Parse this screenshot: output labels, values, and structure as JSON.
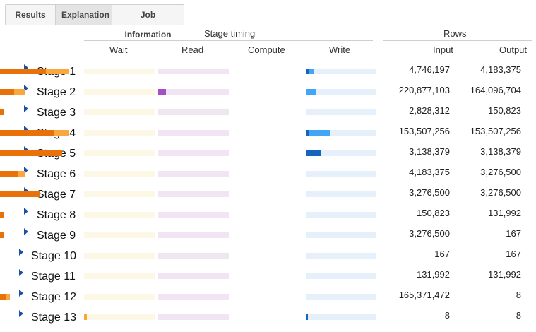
{
  "tabs": [
    "Results",
    "Explanation",
    "Job Information"
  ],
  "active_tab": "Explanation",
  "table": {
    "stage_timing_header": "Stage timing",
    "rows_header": "Rows",
    "columns": {
      "wait": "Wait",
      "read": "Read",
      "compute": "Compute",
      "write": "Write",
      "input": "Input",
      "output": "Output"
    }
  },
  "colors": {
    "wait_avg": "#f7a833",
    "wait_bg": "#fdf8e6",
    "read_avg": "#a64fc3",
    "read_max": "#d9aee5",
    "read_bg": "#f1e4f3",
    "compute_avg": "#e8710a",
    "compute_max": "#f9a73e",
    "compute_bg": "#fdefdc",
    "write_avg": "#1565c0",
    "write_max": "#42a5f5",
    "write_bg": "#e6f0fa",
    "expand_icon": "#1e4fa8"
  },
  "stages": [
    {
      "name": "Stage 1",
      "input": "4,746,197",
      "output": "4,183,375",
      "wait": [
        0,
        0
      ],
      "read": [
        0,
        0
      ],
      "compute": [
        0.65,
        0.98
      ],
      "write": [
        0.05,
        0.11
      ]
    },
    {
      "name": "Stage 2",
      "input": "220,877,103",
      "output": "164,096,704",
      "wait": [
        0,
        0
      ],
      "read": [
        0.11,
        0.11
      ],
      "compute": [
        0.2,
        0.36
      ],
      "write": [
        0.01,
        0.15
      ]
    },
    {
      "name": "Stage 3",
      "input": "2,828,312",
      "output": "150,823",
      "wait": [
        0,
        0
      ],
      "read": [
        0,
        0
      ],
      "compute": [
        0.06,
        0.06
      ],
      "write": [
        0,
        0
      ]
    },
    {
      "name": "Stage 4",
      "input": "153,507,256",
      "output": "153,507,256",
      "wait": [
        0,
        0
      ],
      "read": [
        0,
        0
      ],
      "compute": [
        0.76,
        0.98
      ],
      "write": [
        0.05,
        0.35
      ]
    },
    {
      "name": "Stage 5",
      "input": "3,138,379",
      "output": "3,138,379",
      "wait": [
        0,
        0
      ],
      "read": [
        0,
        0
      ],
      "compute": [
        0.88,
        0.88
      ],
      "write": [
        0.22,
        0.22
      ]
    },
    {
      "name": "Stage 6",
      "input": "4,183,375",
      "output": "3,276,500",
      "wait": [
        0,
        0
      ],
      "read": [
        0,
        0
      ],
      "compute": [
        0.26,
        0.36
      ],
      "write": [
        0.01,
        0.01
      ]
    },
    {
      "name": "Stage 7",
      "input": "3,276,500",
      "output": "3,276,500",
      "wait": [
        0,
        0
      ],
      "read": [
        0,
        0
      ],
      "compute": [
        0.57,
        0.57
      ],
      "write": [
        0,
        0
      ]
    },
    {
      "name": "Stage 8",
      "input": "150,823",
      "output": "131,992",
      "wait": [
        0,
        0
      ],
      "read": [
        0,
        0
      ],
      "compute": [
        0.05,
        0.05
      ],
      "write": [
        0.01,
        0.01
      ]
    },
    {
      "name": "Stage 9",
      "input": "3,276,500",
      "output": "167",
      "wait": [
        0,
        0
      ],
      "read": [
        0,
        0
      ],
      "compute": [
        0.05,
        0.05
      ],
      "write": [
        0,
        0
      ]
    },
    {
      "name": "Stage 10",
      "input": "167",
      "output": "167",
      "wait": [
        0,
        0
      ],
      "read": [
        0,
        0
      ],
      "compute": [
        0,
        0
      ],
      "write": [
        0,
        0
      ]
    },
    {
      "name": "Stage 11",
      "input": "131,992",
      "output": "131,992",
      "wait": [
        0,
        0
      ],
      "read": [
        0,
        0
      ],
      "compute": [
        0,
        0
      ],
      "write": [
        0,
        0
      ]
    },
    {
      "name": "Stage 12",
      "input": "165,371,472",
      "output": "8",
      "wait": [
        0,
        0
      ],
      "read": [
        0,
        0
      ],
      "compute": [
        0.09,
        0.14
      ],
      "write": [
        0,
        0
      ]
    },
    {
      "name": "Stage 13",
      "input": "8",
      "output": "8",
      "wait": [
        0.04,
        0.04
      ],
      "read": [
        0,
        0
      ],
      "compute": [
        0,
        0
      ],
      "write": [
        0.03,
        0.03
      ]
    }
  ]
}
